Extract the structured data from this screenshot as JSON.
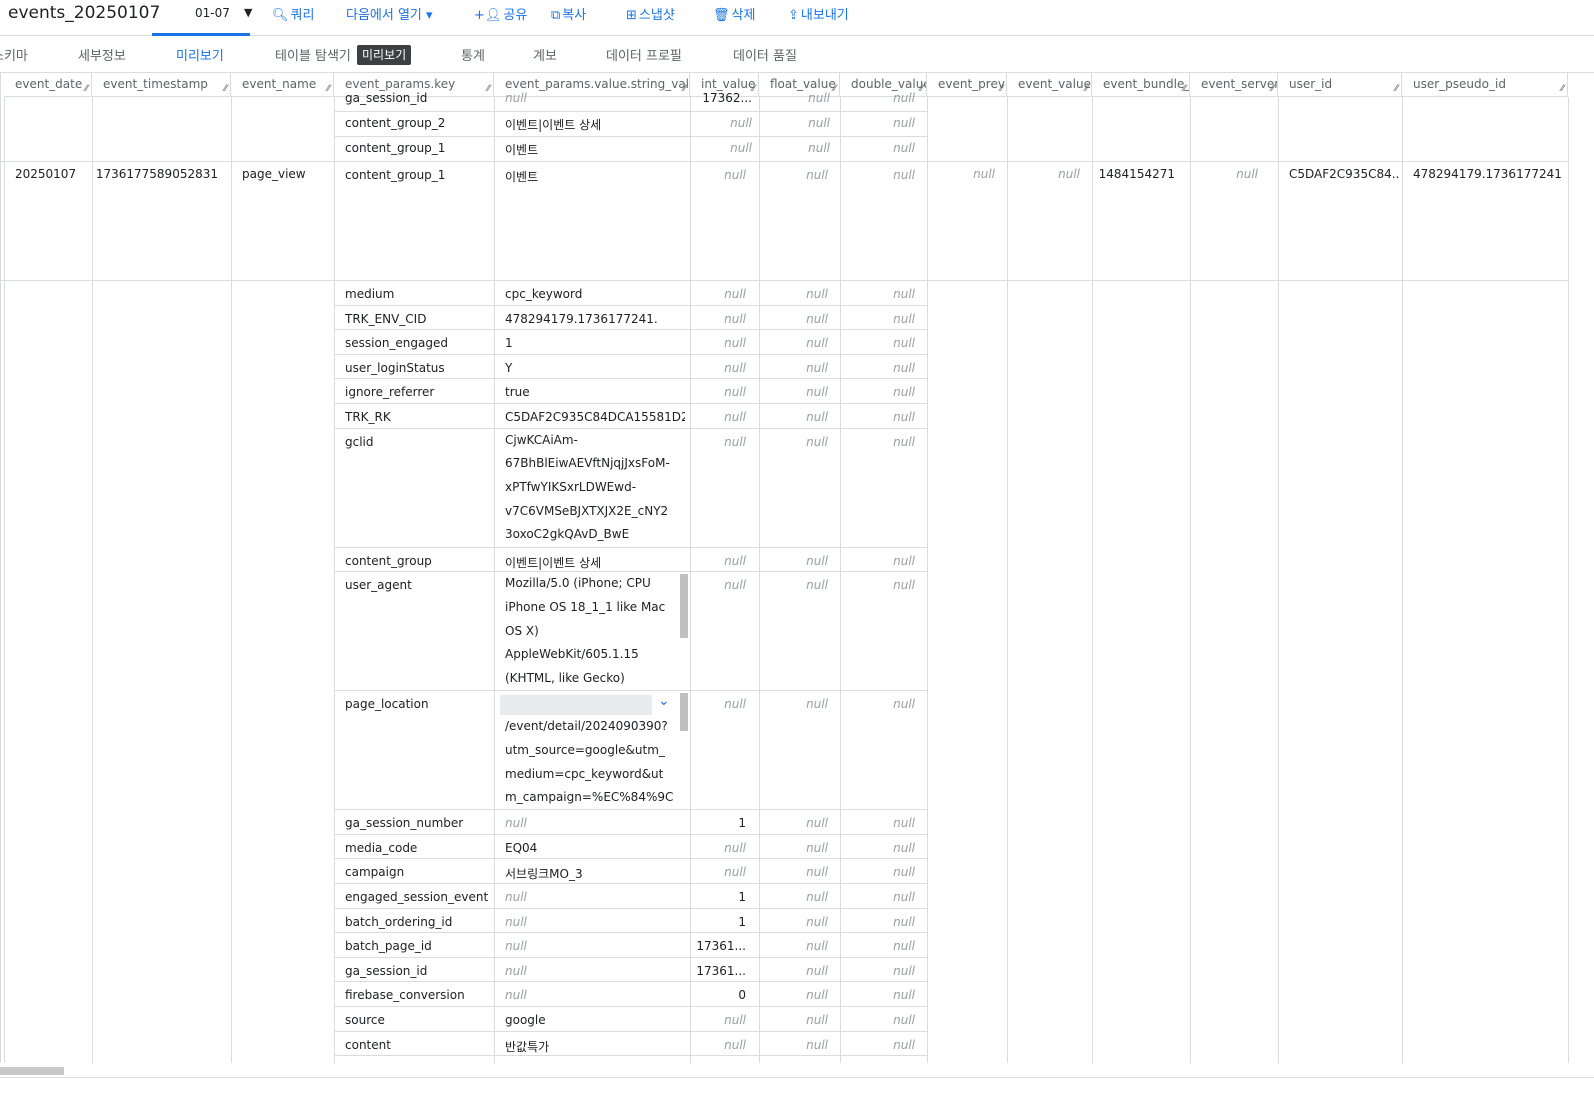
{
  "toolbar": {
    "title": "events_20250107",
    "date": "01-07",
    "query": "쿼리",
    "open_in": "다음에서 열기",
    "share": "공유",
    "copy": "복사",
    "snapshot": "스냅샷",
    "delete": "삭제",
    "export": "내보내기"
  },
  "tabs": {
    "schema": "스키마",
    "details": "세부정보",
    "preview": "미리보기",
    "explorer": "테이블 탐색기",
    "explorer_badge": "미리보기",
    "stats": "통계",
    "lineage": "계보",
    "profile": "데이터 프로필",
    "quality": "데이터 품질"
  },
  "columns": [
    "event_date",
    "event_timestamp",
    "event_name",
    "event_params.key",
    "event_params.value.string_value",
    "int_value",
    "float_value",
    "double_value",
    "event_previo",
    "event_value_i",
    "event_bundle_se",
    "event_server_t",
    "user_id",
    "user_pseudo_id"
  ],
  "null_text": "null",
  "prev_rows": [
    {
      "key": "ga_session_id",
      "str": "null",
      "int": "17362..."
    },
    {
      "key": "content_group_2",
      "str": "이벤트|이벤트 상세",
      "int": "null"
    },
    {
      "key": "content_group_1",
      "str": "이벤트",
      "int": "null"
    }
  ],
  "row": {
    "event_date": "20250107",
    "event_timestamp": "1736177589052831",
    "event_name": "page_view",
    "event_previous": "null",
    "event_value": "null",
    "event_bundle": "1484154271",
    "event_server": "null",
    "user_id": "C5DAF2C935C84...",
    "user_pseudo_id": "478294179.1736177241"
  },
  "params": [
    {
      "key": "content_group_1",
      "str": "이벤트",
      "int": "null"
    },
    {
      "key": "medium",
      "str": "cpc_keyword",
      "int": "null"
    },
    {
      "key": "TRK_ENV_CID",
      "str": "478294179.1736177241.",
      "int": "null"
    },
    {
      "key": "session_engaged",
      "str": "1",
      "int": "null"
    },
    {
      "key": "user_loginStatus",
      "str": "Y",
      "int": "null"
    },
    {
      "key": "ignore_referrer",
      "str": "true",
      "int": "null"
    },
    {
      "key": "TRK_RK",
      "str": "C5DAF2C935C84DCA15581D2...",
      "int": "null"
    },
    {
      "key": "gclid",
      "str_lines": [
        "CjwKCAiAm-",
        "67BhBlEiwAEVftNjqjJxsFoM-",
        "xPTfwYIKSxrLDWEwd-",
        "v7C6VMSeBJXTXJX2E_cNY2",
        "3oxoC2gkQAvD_BwE"
      ],
      "int": "null"
    },
    {
      "key": "content_group",
      "str": "이벤트|이벤트 상세",
      "int": "null"
    },
    {
      "key": "user_agent",
      "str_lines": [
        "Mozilla/5.0 (iPhone; CPU",
        "iPhone OS 18_1_1 like Mac",
        "OS X)",
        "AppleWebKit/605.1.15",
        "(KHTML, like Gecko)"
      ],
      "int": "null"
    },
    {
      "key": "page_location",
      "str_lines": [
        "/event/detail/2024090390?",
        "utm_source=google&utm_",
        "medium=cpc_keyword&ut",
        "m_campaign=%EC%84%9C"
      ],
      "int": "null"
    },
    {
      "key": "ga_session_number",
      "str": "null",
      "int": "1"
    },
    {
      "key": "media_code",
      "str": "EQ04",
      "int": "null"
    },
    {
      "key": "campaign",
      "str": "서브링크MO_3",
      "int": "null"
    },
    {
      "key": "engaged_session_event",
      "str": "null",
      "int": "1"
    },
    {
      "key": "batch_ordering_id",
      "str": "null",
      "int": "1"
    },
    {
      "key": "batch_page_id",
      "str": "null",
      "int": "17361..."
    },
    {
      "key": "ga_session_id",
      "str": "null",
      "int": "17361..."
    },
    {
      "key": "firebase_conversion",
      "str": "null",
      "int": "0"
    },
    {
      "key": "source",
      "str": "google",
      "int": "null"
    },
    {
      "key": "content",
      "str": "반값특가",
      "int": "null"
    }
  ]
}
